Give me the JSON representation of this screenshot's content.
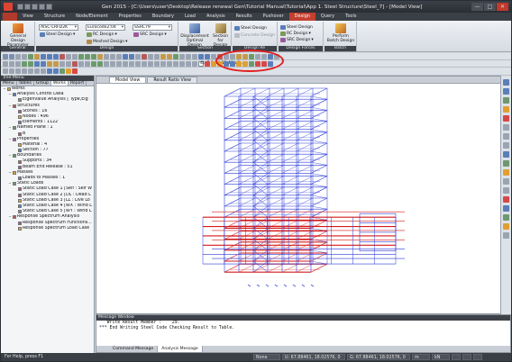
{
  "title_bar": {
    "title": "Gen 2015 - [C:\\Users\\user\\Desktop\\Release renewal Gen\\Tutorial Manual\\Tutorial\\App 1. Steel Structure\\Steel_7] - [Model View]",
    "minimize": "—",
    "maximize": "□",
    "close": "✕"
  },
  "menu": {
    "tabs": [
      "View",
      "Structure",
      "Node/Element",
      "Properties",
      "Boundary",
      "Load",
      "Analysis",
      "Results",
      "Pushover",
      "Design",
      "Query",
      "Tools"
    ],
    "active_tab": "Design"
  },
  "ribbon": {
    "general": {
      "button": "General Design Parameter",
      "label": "General"
    },
    "design": {
      "code1": "AISC-LRFD2K",
      "code2": "Eurocode2:04",
      "code3": "SSRC79",
      "steel": "Steel Design",
      "rc": "RC Design",
      "meshed": "Meshed Design",
      "src": "SRC Design",
      "label": "Design"
    },
    "section": {
      "displacement": "Displacement Optimal Design",
      "section_for_design": "Section for Design",
      "label": "Section"
    },
    "design_forces": {
      "steel": "Steel Design",
      "concrete": "Concrete Design",
      "label": "Design Re"
    },
    "design_report": {
      "steel": "Steel Design",
      "rc": "RC Design",
      "src": "SRC Design",
      "label": "Design Forces"
    },
    "batch": {
      "button": "Perform Batch Design",
      "label": "Batch"
    }
  },
  "toolbar": {
    "select_box": "4to7 9 10 12 40to8..."
  },
  "tree_menu": {
    "header": "Tree Menu",
    "tabs": [
      "Menu",
      "Tables",
      "Group",
      "Works",
      "Report"
    ],
    "active_tab": "Works",
    "nodes": [
      {
        "text": "Works",
        "level": 0,
        "toggle": "−"
      },
      {
        "text": "Analysis Control Data",
        "level": 1,
        "toggle": "−"
      },
      {
        "text": "Eigenvalue Analysis [ Type,Eig",
        "level": 2,
        "toggle": ""
      },
      {
        "text": "Structures",
        "level": 1,
        "toggle": "−"
      },
      {
        "text": "Stories : 16",
        "level": 2,
        "toggle": ""
      },
      {
        "text": "Nodes : 496",
        "level": 2,
        "toggle": ""
      },
      {
        "text": "Elements : 1122",
        "level": 2,
        "toggle": ""
      },
      {
        "text": "Named Plane : 1",
        "level": 1,
        "toggle": "−"
      },
      {
        "text": "B",
        "level": 2,
        "toggle": ""
      },
      {
        "text": "Properties",
        "level": 1,
        "toggle": "−"
      },
      {
        "text": "Material : 4",
        "level": 2,
        "toggle": ""
      },
      {
        "text": "Section : 77",
        "level": 2,
        "toggle": ""
      },
      {
        "text": "Boundaries",
        "level": 1,
        "toggle": "−"
      },
      {
        "text": "Supports : 34",
        "level": 2,
        "toggle": ""
      },
      {
        "text": "Beam End Release : 51",
        "level": 2,
        "toggle": ""
      },
      {
        "text": "Masses",
        "level": 1,
        "toggle": "−"
      },
      {
        "text": "Loads to Masses : 1",
        "level": 2,
        "toggle": ""
      },
      {
        "text": "Static Loads",
        "level": 1,
        "toggle": "−"
      },
      {
        "text": "Static Load Case 1 [Self : Self W",
        "level": 2,
        "toggle": ""
      },
      {
        "text": "Static Load Case 2 [DL : Dead L",
        "level": 2,
        "toggle": ""
      },
      {
        "text": "Static Load Case 3 [LL : Live Lo",
        "level": 2,
        "toggle": ""
      },
      {
        "text": "Static Load Case 4 [WX : Wind L",
        "level": 2,
        "toggle": ""
      },
      {
        "text": "Static Load Case 5 [WY : Wind L",
        "level": 2,
        "toggle": ""
      },
      {
        "text": "Response Spectrum Analysis",
        "level": 1,
        "toggle": "−"
      },
      {
        "text": "Response Spectrum Functions...",
        "level": 2,
        "toggle": ""
      },
      {
        "text": "Response Spectrum Load Case",
        "level": 2,
        "toggle": ""
      }
    ]
  },
  "view_tabs": [
    "Model View",
    "Result Ratio View"
  ],
  "message_window": {
    "header": "Message Window",
    "lines": [
      "   Write Result Member :    29.",
      "*** End Writing Steel Code Checking Result to Table."
    ],
    "tabs": [
      "Command Message",
      "Analysis Message"
    ],
    "active_tab": "Analysis Message"
  },
  "status_bar": {
    "help": "For Help, press F1",
    "mode": "None",
    "coords1": "U: 67.88461, 18.02576, 0",
    "coords2": "G: 67.88461, 18.02576, 0",
    "unit1": "m",
    "unit2": "kN"
  },
  "colors": {
    "ribbon_dark": "#3d424a",
    "menu_active": "#c4402f",
    "frame_blue": "#2b3ad8",
    "frame_red": "#d41a1a",
    "highlight": "#e02020"
  }
}
